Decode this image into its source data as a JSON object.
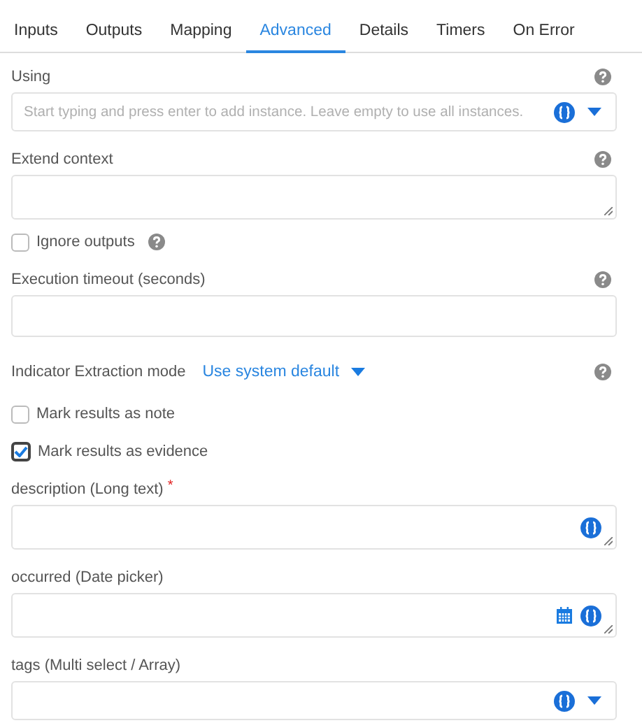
{
  "tabs": [
    {
      "label": "Inputs",
      "selected": false
    },
    {
      "label": "Outputs",
      "selected": false
    },
    {
      "label": "Mapping",
      "selected": false
    },
    {
      "label": "Advanced",
      "selected": true
    },
    {
      "label": "Details",
      "selected": false
    },
    {
      "label": "Timers",
      "selected": false
    },
    {
      "label": "On Error",
      "selected": false
    }
  ],
  "fields": [
    {
      "kind": "instance-select",
      "label": "Using",
      "help": true,
      "placeholder": "Start typing and press enter to add instance. Leave empty to use all instances."
    },
    {
      "kind": "textarea",
      "label": "Extend context",
      "help": true
    },
    {
      "kind": "checkbox",
      "label": "Ignore outputs",
      "checked": false,
      "help": true
    },
    {
      "kind": "input",
      "label": "Execution timeout (seconds)",
      "help": true
    },
    {
      "kind": "dropdown",
      "label": "Indicator Extraction mode",
      "value": "Use system default",
      "help": true
    },
    {
      "kind": "checkbox",
      "label": "Mark results as note",
      "checked": false,
      "help": false
    },
    {
      "kind": "checkbox",
      "label": "Mark results as evidence",
      "checked": true,
      "focused": true,
      "help": false
    },
    {
      "kind": "long-text",
      "label": "description (Long text)",
      "required_mark": "*",
      "help": false
    },
    {
      "kind": "date",
      "label": "occurred (Date picker)",
      "help": false
    },
    {
      "kind": "multi-select",
      "label": "tags (Multi select / Array)",
      "help": false
    }
  ]
}
